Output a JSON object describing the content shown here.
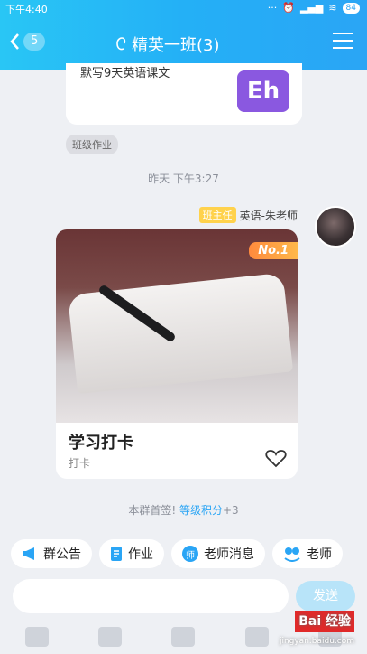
{
  "status": {
    "time": "下午4:40",
    "battery": "84"
  },
  "header": {
    "back_count": "5",
    "title": "精英一班(3)"
  },
  "prev_card": {
    "text": "默写9天英语课文",
    "logo": "Eh",
    "tag": "班级作业"
  },
  "timestamp": "昨天 下午3:27",
  "message": {
    "role": "班主任",
    "sender": "英语-朱老师",
    "badge": "No.1",
    "title": "学习打卡",
    "subtitle": "打卡"
  },
  "notice": {
    "prefix": "本群首签! ",
    "link": "等级积分",
    "suffix": "+3"
  },
  "quick_actions": [
    {
      "label": "群公告",
      "icon": "megaphone-icon",
      "color": "#2aa5f5"
    },
    {
      "label": "作业",
      "icon": "document-icon",
      "color": "#2aa5f5"
    },
    {
      "label": "老师消息",
      "icon": "teacher-icon",
      "color": "#2aa5f5"
    },
    {
      "label": "老师",
      "icon": "teacher-group-icon",
      "color": "#2aa5f5"
    }
  ],
  "input": {
    "placeholder": "",
    "send_label": "发送"
  },
  "watermark": {
    "text": "Bai 经验",
    "sub": "jingyan.baidu.com"
  }
}
